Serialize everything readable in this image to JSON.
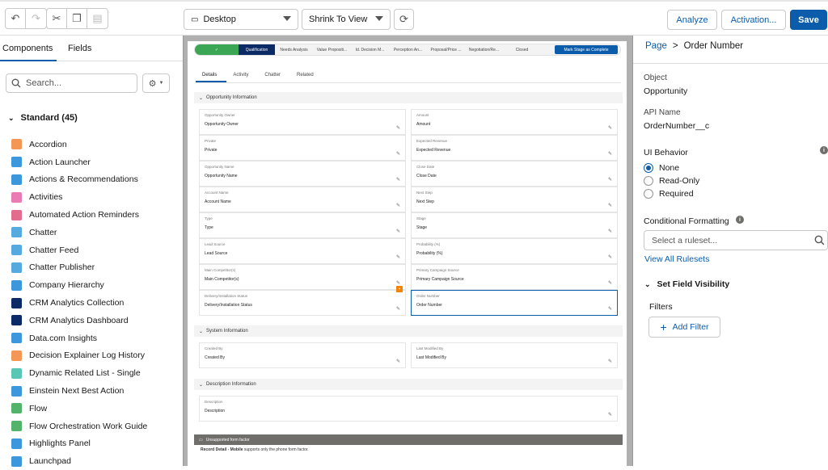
{
  "toolbar": {
    "undo_icon": "undo-icon",
    "redo_icon": "redo-icon",
    "cut_icon": "cut-icon",
    "copy_icon": "copy-icon",
    "paste_icon": "paste-icon",
    "device_select": "Desktop",
    "zoom_select": "Shrink To View",
    "refresh_icon": "refresh-icon",
    "analyze_label": "Analyze",
    "activation_label": "Activation...",
    "save_label": "Save",
    "accent": "#0b5cab"
  },
  "left": {
    "tabs": [
      "Components",
      "Fields"
    ],
    "search_placeholder": "Search...",
    "standard_header": "Standard (45)",
    "components": [
      {
        "label": "Accordion",
        "icon": "accordion-icon",
        "color": "#f49756"
      },
      {
        "label": "Action Launcher",
        "icon": "action-launcher-icon",
        "color": "#3c97dd"
      },
      {
        "label": "Actions & Recommendations",
        "icon": "actions-icon",
        "color": "#3c97dd"
      },
      {
        "label": "Activities",
        "icon": "activities-icon",
        "color": "#ea7bb3"
      },
      {
        "label": "Automated Action Reminders",
        "icon": "reminder-icon",
        "color": "#e36b8e"
      },
      {
        "label": "Chatter",
        "icon": "chatter-icon",
        "color": "#56aadf"
      },
      {
        "label": "Chatter Feed",
        "icon": "chatter-feed-icon",
        "color": "#56aadf"
      },
      {
        "label": "Chatter Publisher",
        "icon": "chatter-publisher-icon",
        "color": "#56aadf"
      },
      {
        "label": "Company Hierarchy",
        "icon": "hierarchy-icon",
        "color": "#3c97dd"
      },
      {
        "label": "CRM Analytics Collection",
        "icon": "analytics-icon",
        "color": "#0b2a66"
      },
      {
        "label": "CRM Analytics Dashboard",
        "icon": "analytics-dashboard-icon",
        "color": "#0b2a66"
      },
      {
        "label": "Data.com Insights",
        "icon": "datacom-icon",
        "color": "#3c97dd"
      },
      {
        "label": "Decision Explainer Log History",
        "icon": "decision-icon",
        "color": "#f49756"
      },
      {
        "label": "Dynamic Related List - Single",
        "icon": "related-list-icon",
        "color": "#5ac6b6"
      },
      {
        "label": "Einstein Next Best Action",
        "icon": "einstein-icon",
        "color": "#3c97dd"
      },
      {
        "label": "Flow",
        "icon": "flow-icon",
        "color": "#54b36a"
      },
      {
        "label": "Flow Orchestration Work Guide",
        "icon": "flow-orchestration-icon",
        "color": "#54b36a"
      },
      {
        "label": "Highlights Panel",
        "icon": "highlights-icon",
        "color": "#3c97dd"
      },
      {
        "label": "Launchpad",
        "icon": "launchpad-icon",
        "color": "#3c97dd"
      }
    ]
  },
  "canvas": {
    "stages": [
      "Qualification",
      "Needs Analysis",
      "Value Propositi...",
      "Id. Decision M...",
      "Perception An...",
      "Proposal/Price ...",
      "Negotiation/Re...",
      "Closed"
    ],
    "mark_stage": "Mark Stage as Complete",
    "detail_tabs": [
      "Details",
      "Activity",
      "Chatter",
      "Related"
    ],
    "sections": {
      "opportunity": "Opportunity Information",
      "system": "System Information",
      "description": "Description Information"
    },
    "left_fields": [
      {
        "label": "Opportunity Owner",
        "value": "Opportunity Owner"
      },
      {
        "label": "Private",
        "value": "Private"
      },
      {
        "label": "Opportunity Name",
        "value": "Opportunity Name"
      },
      {
        "label": "Account Name",
        "value": "Account Name"
      },
      {
        "label": "Type",
        "value": "Type"
      },
      {
        "label": "Lead Source",
        "value": "Lead Source"
      },
      {
        "label": "Main Competitor(s)",
        "value": "Main Competitor(s)"
      },
      {
        "label": "Delivery/Installation Status",
        "value": "Delivery/Installation Status"
      }
    ],
    "right_fields": [
      {
        "label": "Amount",
        "value": "Amount"
      },
      {
        "label": "Expected Revenue",
        "value": "Expected Revenue"
      },
      {
        "label": "Close Date",
        "value": "Close Date"
      },
      {
        "label": "Next Step",
        "value": "Next Step"
      },
      {
        "label": "Stage",
        "value": "Stage"
      },
      {
        "label": "Probability (%)",
        "value": "Probability (%)"
      },
      {
        "label": "Primary Campaign Source",
        "value": "Primary Campaign Source"
      },
      {
        "label": "Order Number",
        "value": "Order Number"
      }
    ],
    "system_fields": [
      {
        "label": "Created By",
        "value": "Created By"
      },
      {
        "label": "Last Modified By",
        "value": "Last Modified By"
      }
    ],
    "description_field": {
      "label": "Description",
      "value": "Description"
    },
    "unsupported": "Unsupported form factor",
    "unsupported_desc_bold": "Record Detail - Mobile",
    "unsupported_desc": "supports only the phone form factor."
  },
  "right": {
    "breadcrumb_page": "Page",
    "breadcrumb_sep": ">",
    "breadcrumb_current": "Order Number",
    "object_label": "Object",
    "object_value": "Opportunity",
    "api_label": "API Name",
    "api_value": "OrderNumber__c",
    "ui_behavior_label": "UI Behavior",
    "radio_options": [
      "None",
      "Read-Only",
      "Required"
    ],
    "selected_radio": "None",
    "conditional_label": "Conditional Formatting",
    "ruleset_placeholder": "Select a ruleset...",
    "view_rules": "View All Rulesets",
    "set_visibility": "Set Field Visibility",
    "filters_label": "Filters",
    "add_filter": "Add Filter"
  }
}
